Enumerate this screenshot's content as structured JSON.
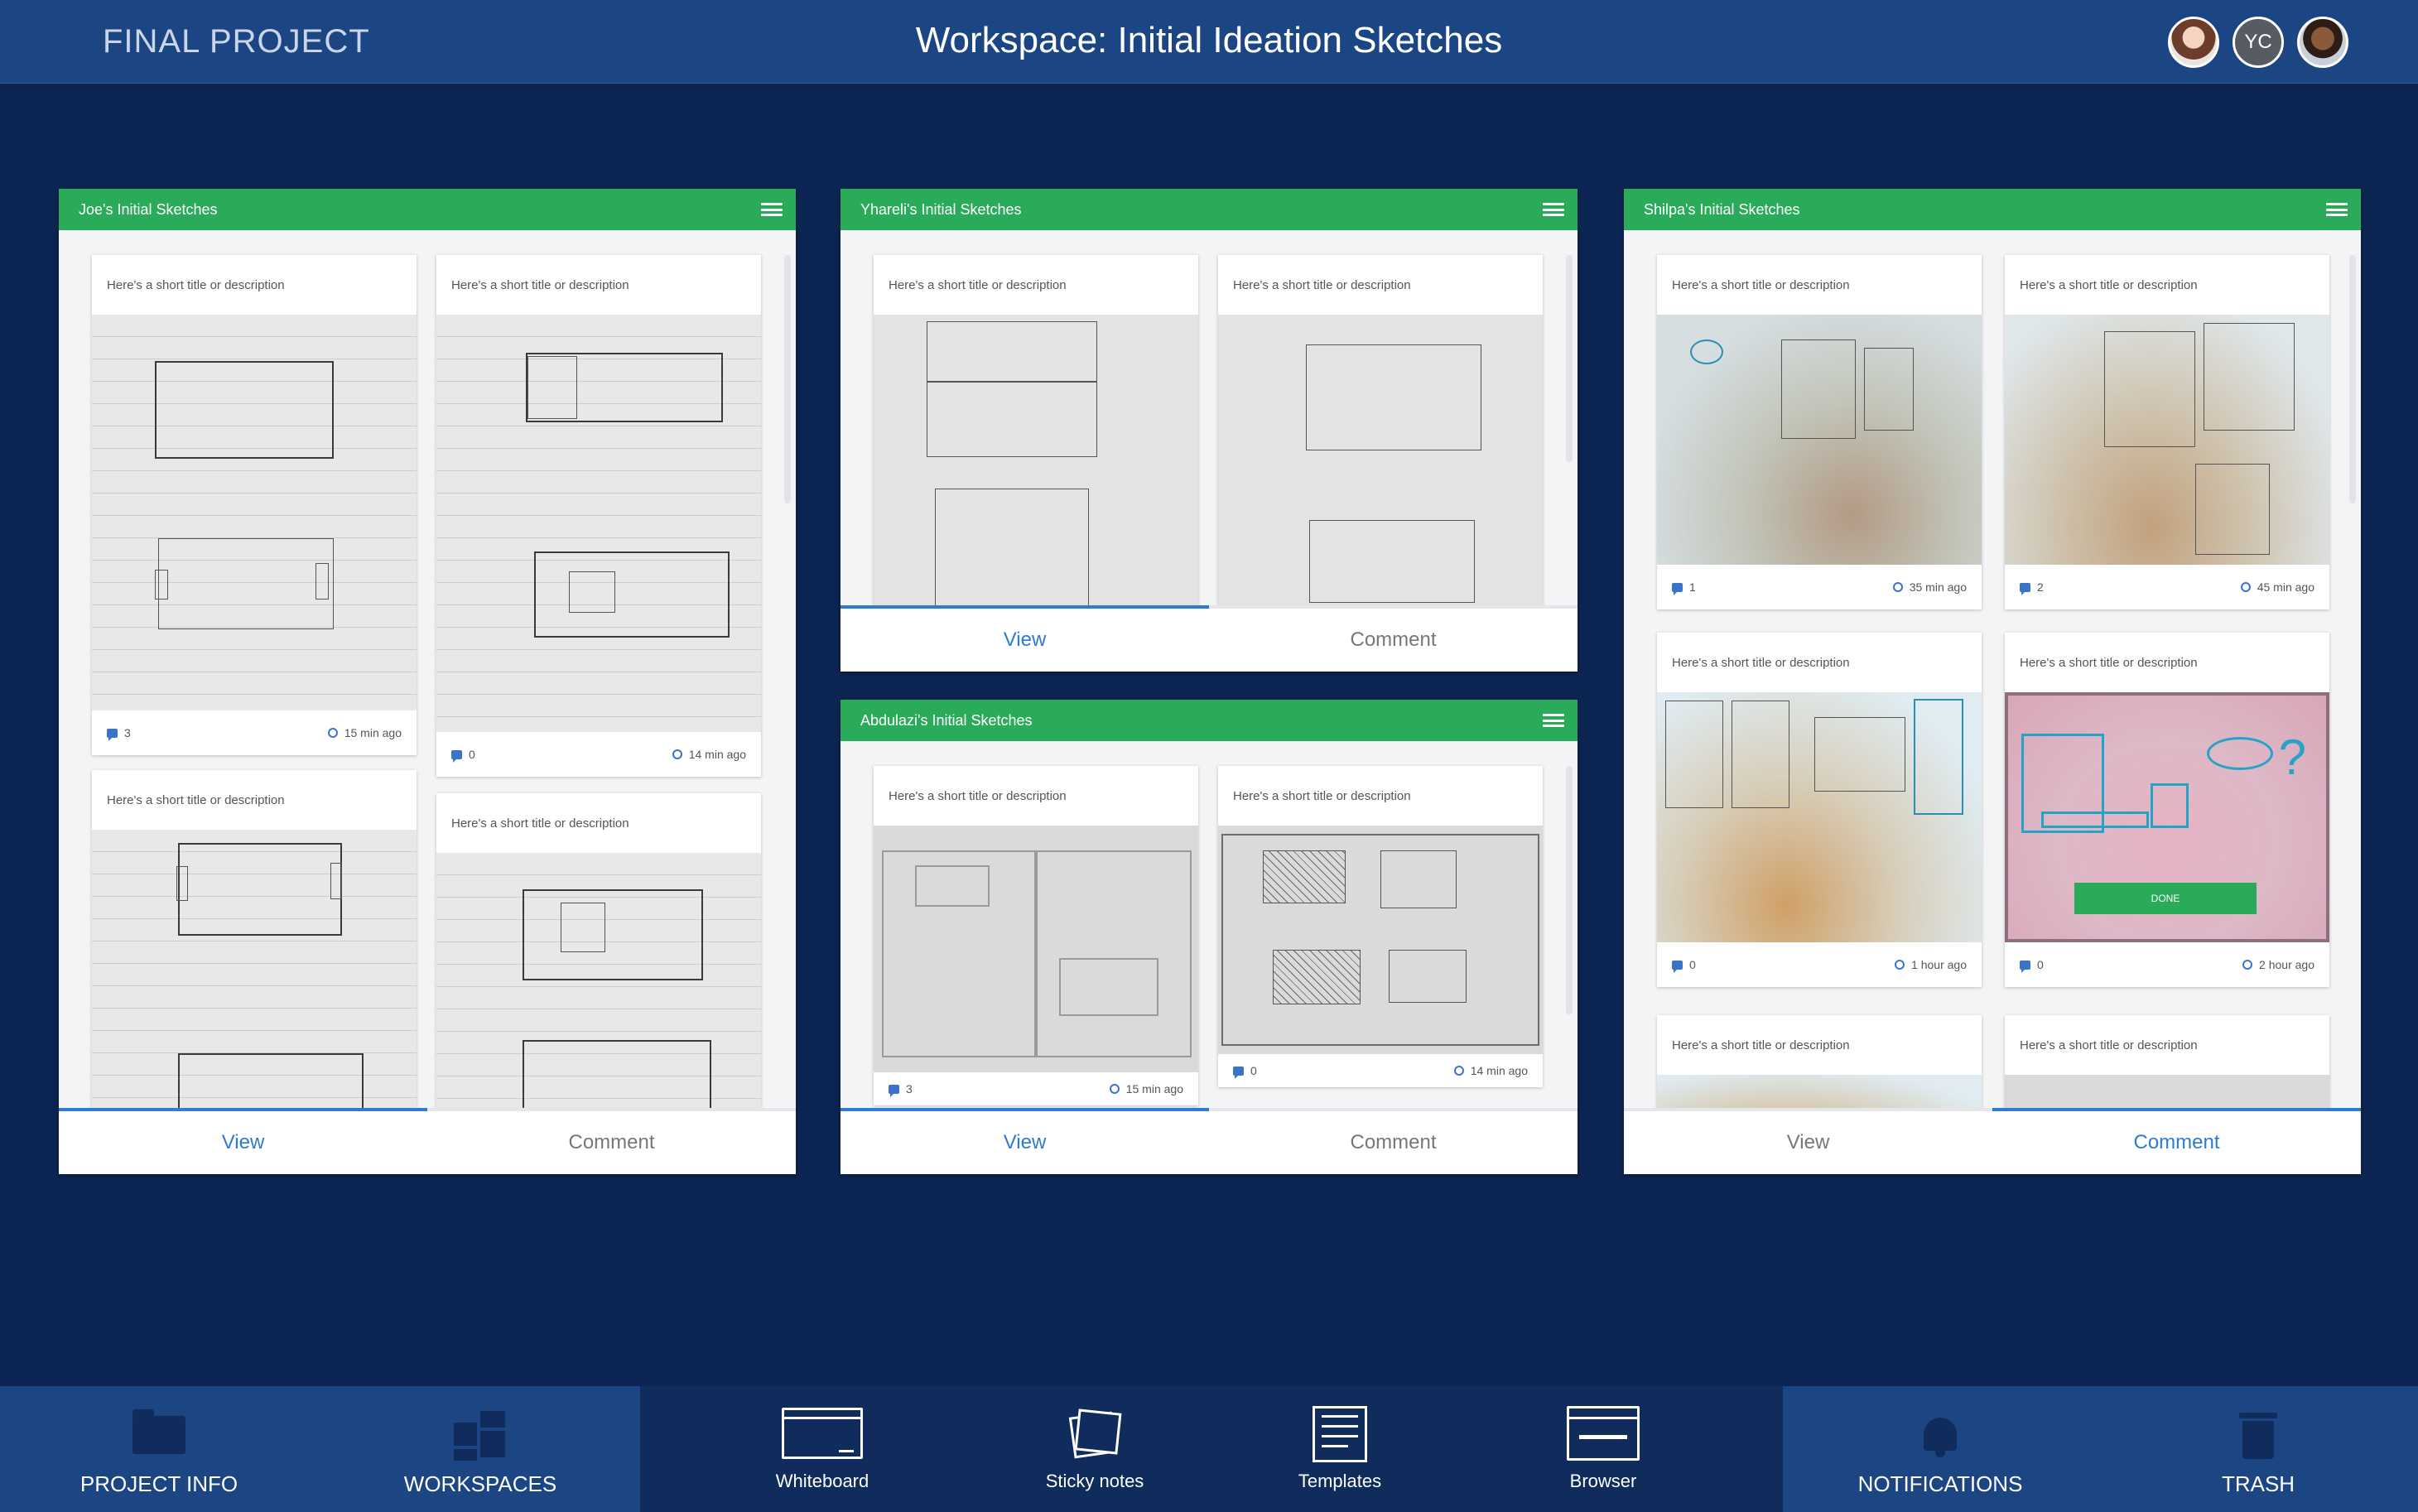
{
  "header": {
    "app_title": "FINAL PROJECT",
    "workspace_title": "Workspace: Initial Ideation Sketches",
    "avatars": [
      {
        "name": "user-avatar-1",
        "initials": ""
      },
      {
        "name": "user-avatar-yc",
        "initials": "YC"
      },
      {
        "name": "user-avatar-3",
        "initials": ""
      }
    ]
  },
  "panels": [
    {
      "title": "Joe's Initial Sketches",
      "tabs": {
        "view": "View",
        "comment": "Comment",
        "active": "view"
      },
      "cards": [
        {
          "title": "Here's a short title or description",
          "comments": "3",
          "time": "15 min ago"
        },
        {
          "title": "Here's a short title or description",
          "comments": "0",
          "time": "14 min ago"
        },
        {
          "title": "Here's a short title or description"
        },
        {
          "title": "Here's a short title or description"
        }
      ]
    },
    {
      "title": "Yhareli's Initial Sketches",
      "tabs": {
        "view": "View",
        "comment": "Comment",
        "active": "view"
      },
      "cards": [
        {
          "title": "Here's a short title or description"
        },
        {
          "title": "Here's a short title or description"
        }
      ]
    },
    {
      "title": "Abdulazi's Initial Sketches",
      "tabs": {
        "view": "View",
        "comment": "Comment",
        "active": "view"
      },
      "cards": [
        {
          "title": "Here's a short title or description",
          "comments": "3",
          "time": "15 min ago"
        },
        {
          "title": "Here's a short title or description",
          "comments": "0",
          "time": "14 min ago"
        }
      ]
    },
    {
      "title": "Shilpa's Initial Sketches",
      "tabs": {
        "view": "View",
        "comment": "Comment",
        "active": "comment"
      },
      "cards": [
        {
          "title": "Here's a short title or description",
          "comments": "1",
          "time": "35 min ago"
        },
        {
          "title": "Here's a short title or description",
          "comments": "2",
          "time": "45 min ago"
        },
        {
          "title": "Here's a short title or description",
          "comments": "0",
          "time": "1 hour ago"
        },
        {
          "title": "Here's a short title or description",
          "comments": "0",
          "time": "2 hour ago",
          "button": "DONE"
        },
        {
          "title": "Here's a short title or description"
        },
        {
          "title": "Here's a short title or description"
        }
      ]
    }
  ],
  "bottom_nav": {
    "project_info": "PROJECT INFO",
    "workspaces": "WORKSPACES",
    "whiteboard": "Whiteboard",
    "sticky_notes": "Sticky notes",
    "templates": "Templates",
    "browser": "Browser",
    "notifications": "NOTIFICATIONS",
    "trash": "TRASH"
  },
  "colors": {
    "background": "#0c2553",
    "header": "#1c4584",
    "panel_header": "#2aab5a",
    "accent": "#2e7bd0"
  }
}
